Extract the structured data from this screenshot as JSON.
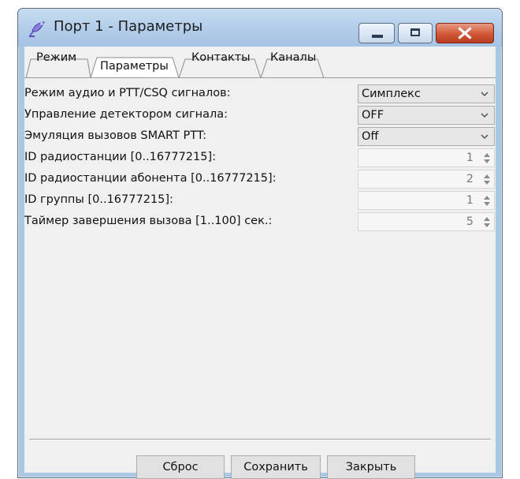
{
  "window": {
    "title": "Порт 1 - Параметры",
    "icon": "satellite-antenna-icon"
  },
  "tabs": [
    {
      "label": "Режим",
      "active": false
    },
    {
      "label": "Параметры",
      "active": true
    },
    {
      "label": "Контакты",
      "active": false
    },
    {
      "label": "Каналы",
      "active": false
    }
  ],
  "fields": [
    {
      "label": "Режим аудио и PTT/CSQ сигналов:",
      "type": "select",
      "value": "Симплекс"
    },
    {
      "label": "Управление детектором сигнала:",
      "type": "select",
      "value": "OFF"
    },
    {
      "label": "Эмуляция вызовов SMART PTT:",
      "type": "select",
      "value": "Off"
    },
    {
      "label": "ID радиостанции [0..16777215]:",
      "type": "spin",
      "value": "1"
    },
    {
      "label": "ID радиостанции абонента [0..16777215]:",
      "type": "spin",
      "value": "2"
    },
    {
      "label": "ID группы [0..16777215]:",
      "type": "spin",
      "value": "1"
    },
    {
      "label": "Таймер завершения вызова [1..100] сек.:",
      "type": "spin",
      "value": "5"
    }
  ],
  "buttons": {
    "reset": "Сброс",
    "save": "Сохранить",
    "close": "Закрыть"
  },
  "colors": {
    "titlebar": "#b2cdea",
    "close_button": "#d25738",
    "dialog_background": "#f0f0f0"
  }
}
